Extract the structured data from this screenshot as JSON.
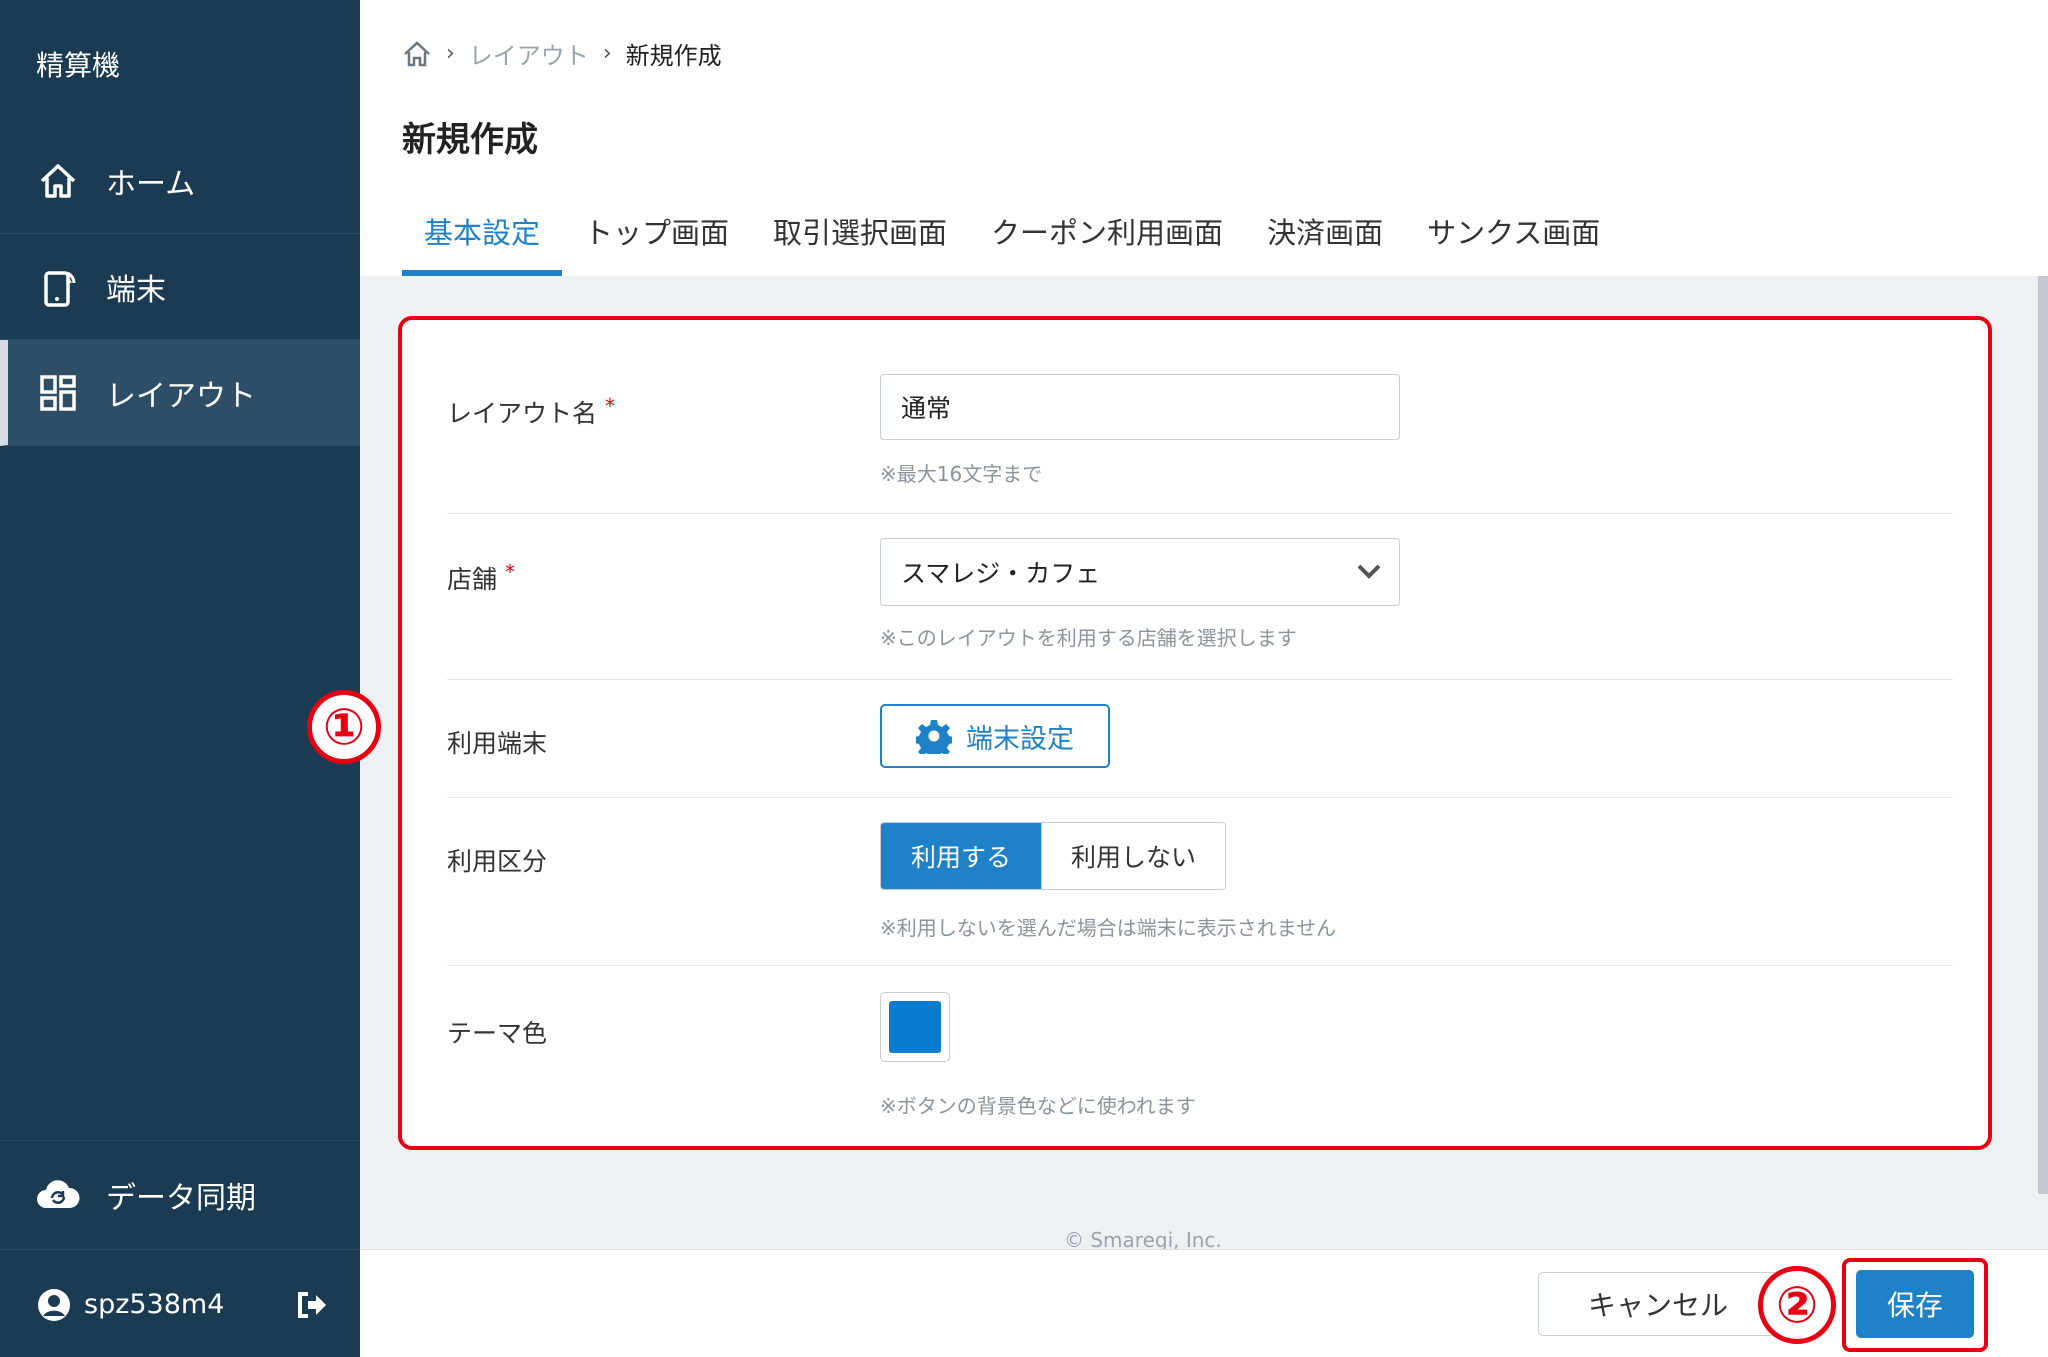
{
  "sidebar": {
    "title": "精算機",
    "items": [
      {
        "label": "ホーム",
        "icon": "home-icon"
      },
      {
        "label": "端末",
        "icon": "tablet-icon"
      },
      {
        "label": "レイアウト",
        "icon": "layout-icon",
        "active": true
      }
    ],
    "sync_label": "データ同期",
    "user_name": "spz538m4"
  },
  "breadcrumb": {
    "items": [
      "レイアウト",
      "新規作成"
    ]
  },
  "page_title": "新規作成",
  "tabs": [
    {
      "label": "基本設定",
      "active": true
    },
    {
      "label": "トップ画面"
    },
    {
      "label": "取引選択画面"
    },
    {
      "label": "クーポン利用画面"
    },
    {
      "label": "決済画面"
    },
    {
      "label": "サンクス画面"
    }
  ],
  "form": {
    "layout_name": {
      "label": "レイアウト名",
      "required_mark": "*",
      "value": "通常",
      "hint": "※最大16文字まで"
    },
    "store": {
      "label": "店舗",
      "required_mark": "*",
      "value": "スマレジ・カフェ",
      "hint": "※このレイアウトを利用する店舗を選択します"
    },
    "device": {
      "label": "利用端末",
      "button_label": "端末設定"
    },
    "usage": {
      "label": "利用区分",
      "options": [
        "利用する",
        "利用しない"
      ],
      "selected": "利用する",
      "hint": "※利用しないを選んだ場合は端末に表示されません"
    },
    "theme_color": {
      "label": "テーマ色",
      "color": "#0a7ccd",
      "hint": "※ボタンの背景色などに使われます"
    }
  },
  "annotations": {
    "one": "①",
    "two": "②"
  },
  "footer": {
    "copyright": "© Smaregi, Inc.",
    "cancel_label": "キャンセル",
    "save_label": "保存"
  },
  "colors": {
    "sidebar_bg": "#1b3b52",
    "accent": "#1f82c8",
    "annotation_red": "#e60012"
  }
}
